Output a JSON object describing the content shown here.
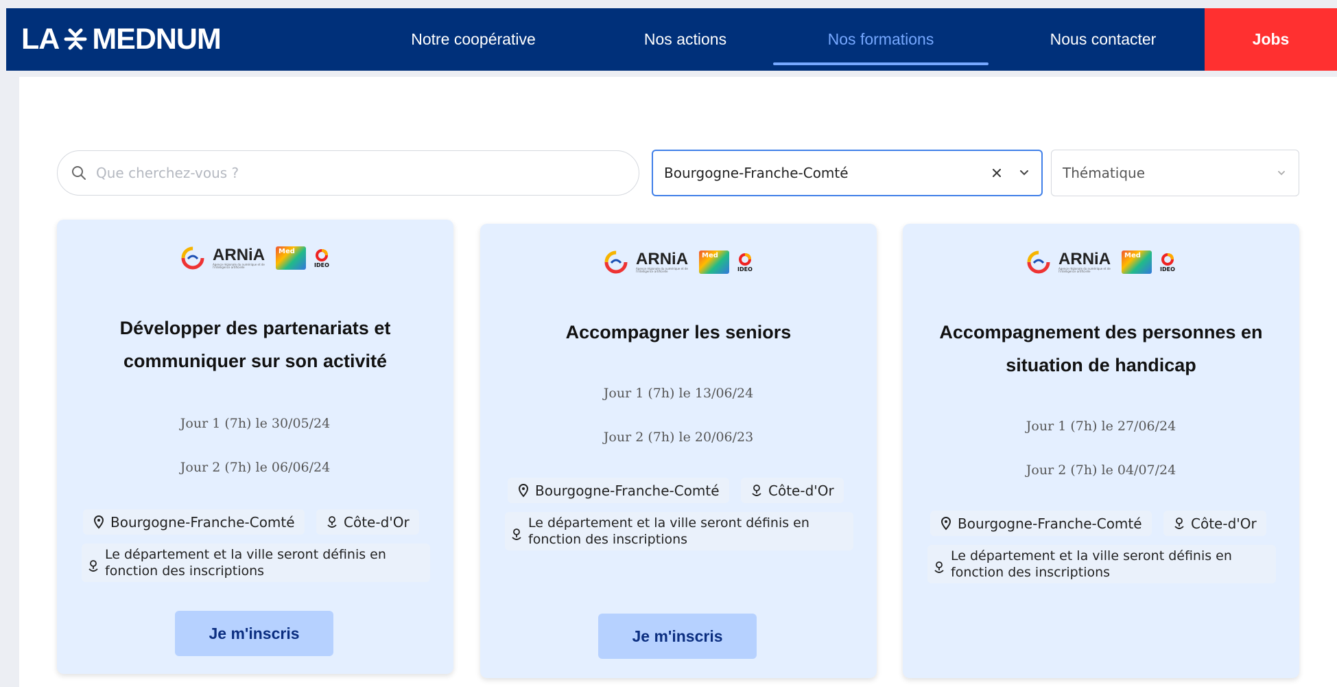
{
  "header": {
    "logo_left": "LA",
    "logo_right": "MEDNUM",
    "nav": [
      {
        "label": "Notre coopérative"
      },
      {
        "label": "Nos actions"
      },
      {
        "label": "Nos formations"
      },
      {
        "label": "Nous contacter"
      }
    ],
    "jobs_label": "Jobs"
  },
  "filters": {
    "search_placeholder": "Que cherchez-vous ?",
    "region_value": "Bourgogne-Franche-Comté",
    "theme_value": "Thématique"
  },
  "partner_logos": {
    "arnia": "ARNiA",
    "arnia_sub": "Agence régionale du numérique et de l'intelligence artificielle",
    "med": "Med",
    "ideo": "IDEO"
  },
  "cards": [
    {
      "title": "Développer des partenariats et communiquer sur son activité",
      "day1": "Jour 1 (7h) le 30/05/24",
      "day2": "Jour 2 (7h) le 06/06/24",
      "region": "Bourgogne-Franche-Comté",
      "department": "Côte-d'Or",
      "notice": "Le département et la ville seront définis en fonction des inscriptions",
      "button": "Je m'inscris"
    },
    {
      "title": "Accompagner les seniors",
      "day1": "Jour 1 (7h) le 13/06/24",
      "day2": "Jour 2 (7h) le 20/06/23",
      "region": "Bourgogne-Franche-Comté",
      "department": "Côte-d'Or",
      "notice": "Le département et la ville seront définis en fonction des inscriptions",
      "button": "Je m'inscris"
    },
    {
      "title": "Accompagnement des personnes en situation de handicap",
      "day1": "Jour 1 (7h) le 27/06/24",
      "day2": "Jour 2 (7h) le 04/07/24",
      "region": "Bourgogne-Franche-Comté",
      "department": "Côte-d'Or",
      "notice": "Le département et la ville seront définis en fonction des inscriptions",
      "button": null
    }
  ],
  "colors": {
    "nav_bg": "#00307a",
    "nav_active": "#76a8ff",
    "jobs_bg": "#ff3030",
    "card_bg": "#e4efff",
    "button_bg": "#b6d1ff"
  },
  "icons": [
    "search-icon",
    "clear-icon",
    "chevron-down-icon",
    "location-pin-icon",
    "map-marker-icon"
  ]
}
